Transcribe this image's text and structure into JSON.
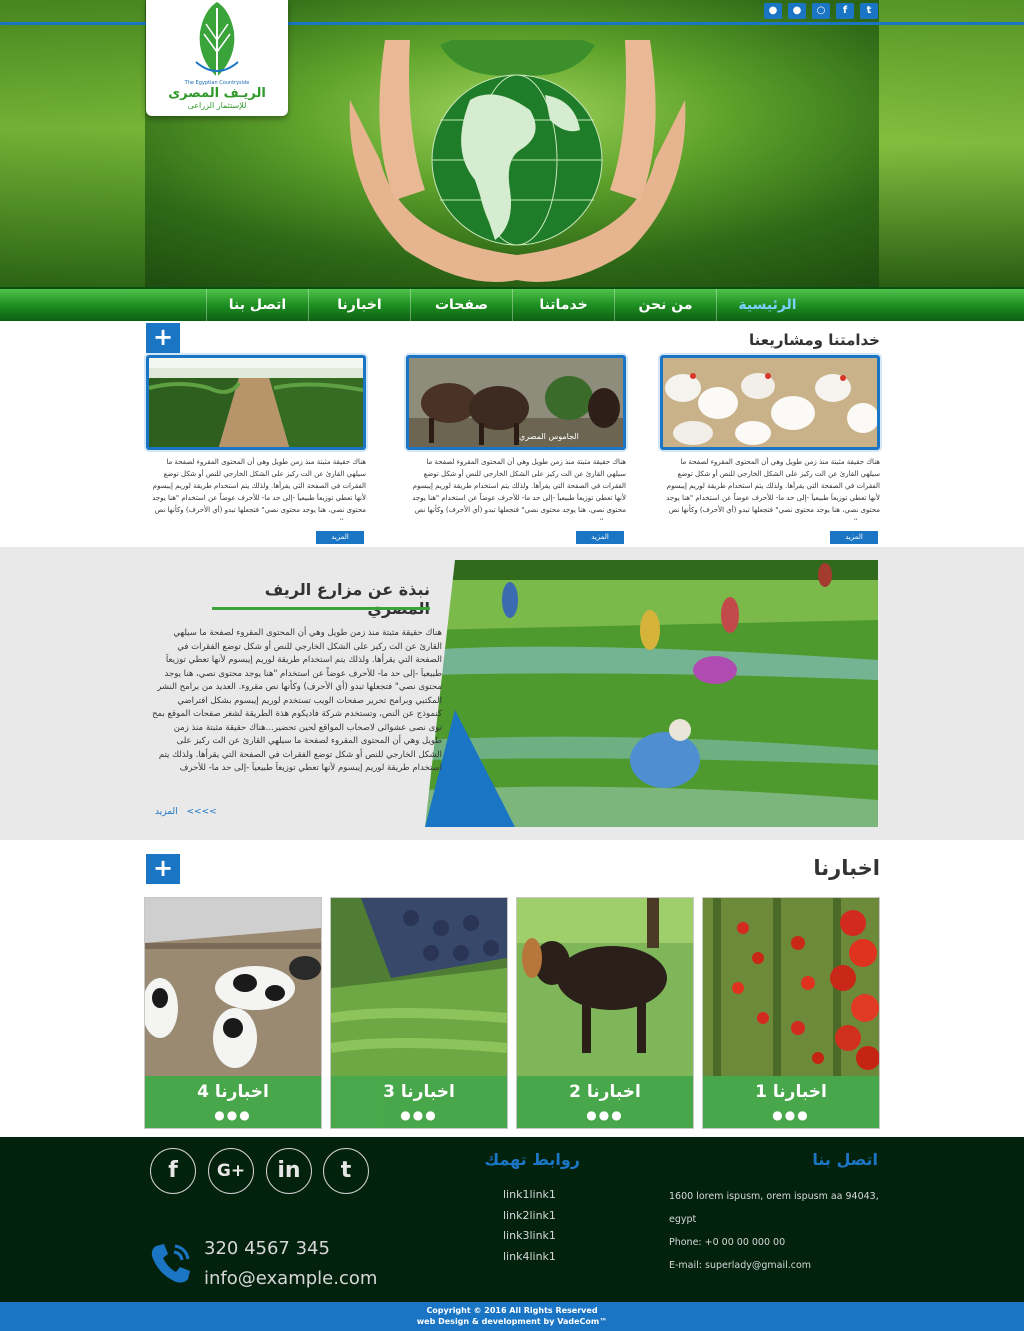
{
  "brand": {
    "name_en": "The Egyptian Countryside",
    "name_ar": "الريـف المصرى",
    "tagline_ar": "للإستثمار الزراعى"
  },
  "topbar": {
    "social_icons": [
      "twitter-icon",
      "facebook-icon",
      "rss-icon",
      "globe-icon",
      "lock-icon"
    ]
  },
  "nav": {
    "items": [
      {
        "label": "الرئيسية",
        "active": true
      },
      {
        "label": "من نحن",
        "active": false
      },
      {
        "label": "خدماتنا",
        "active": false
      },
      {
        "label": "صفحات",
        "active": false
      },
      {
        "label": "اخبارنا",
        "active": false
      },
      {
        "label": "اتصل بنا",
        "active": false
      }
    ]
  },
  "services": {
    "title": "خدامتنا ومشاريعنا",
    "plus": "+",
    "more": "المزيد",
    "items": [
      {
        "image": "chickens",
        "text": "هناك حقيقة مثبتة منذ زمن طويل وهي أن المحتوى المقروء لصفحة ما سيلهي القارئ عن الت ركيز على الشكل الخارجي للنص أو شكل توضع الفقرات في الصفحة التي يقرأها. ولذلك يتم استخدام طريقة لوريم إيبسوم لأنها تعطي توزيعاَ طبيعياَ -إلى حد ما- للأحرف عوضاً عن استخدام \"هنا يوجد محتوى نصي، هنا يوجد محتوى نصي\" فتجعلها تبدو (أي الأحرف) وكأنها نص مقروء. العديد"
      },
      {
        "image": "cattle",
        "caption": "الجاموس المصري",
        "text": "هناك حقيقة مثبتة منذ زمن طويل وهي أن المحتوى المقروء لصفحة ما سيلهي القارئ عن الت ركيز على الشكل الخارجي للنص أو شكل توضع الفقرات في الصفحة التي يقرأها. ولذلك يتم استخدام طريقة لوريم إيبسوم لأنها تعطي توزيعاَ طبيعياَ -إلى حد ما- للأحرف عوضاً عن استخدام \"هنا يوجد محتوى نصي، هنا يوجد محتوى نصي\" فتجعلها تبدو (أي الأحرف) وكأنها نص مقروء. العديد"
      },
      {
        "image": "greenhouse",
        "text": "هناك حقيقة مثبتة منذ زمن طويل وهي أن المحتوى المقروء لصفحة ما سيلهي القارئ عن الت ركيز على الشكل الخارجي للنص أو شكل توضع الفقرات في الصفحة التي يقرأها. ولذلك يتم استخدام طريقة لوريم إيبسوم لأنها تعطي توزيعاَ طبيعياَ -إلى حد ما- للأحرف عوضاً عن استخدام \"هنا يوجد محتوى نصي، هنا يوجد محتوى نصي\" فتجعلها تبدو (أي الأحرف) وكأنها نص مقروء. العديد"
      }
    ]
  },
  "about": {
    "title": "نبذة عن مزارع الريف المصري",
    "text": "هناك حقيقة مثبتة منذ زمن طويل وهي أن المحتوى المقروء لصفحة ما سيلهي القارئ عن الت ركيز على الشكل الخارجي للنص أو شكل توضع الفقرات في الصفحة التي يقرأها. ولذلك يتم استخدام طريقة لوريم إيبسوم لأنها تعطي توزيعاَ طبيعياَ -إلى حد ما- للأحرف عوضاً عن استخدام \"هنا يوجد محتوى نصي، هنا يوجد محتوى نصي\" فتجعلها تبدو (أي الأحرف) وكأنها نص مقروء. العديد من برامح النشر المكتبي وبرامح تحرير صفحات الويب تستخدم لوريم إيبسوم بشكل افتراضي كنموذج عن النص، وتستخدم شركة فاديكوم هذة الطريقة لشغر صفحات الموقع بمح توى نصى عشوائى لاصحاب المواقع لحين تحضير...هناك حقيقة مثبتة منذ زمن طويل وهي أن المحتوى المقروء لصفحة ما سيلهي القارئ عن الت ركيز على الشكل الخارجي للنص أو شكل توضع الفقرات في الصفحة التي يقرأها. ولذلك يتم استخدام طريقة لوريم إيبسوم لأنها تعطي توزيعاَ طبيعياَ -إلى حد ما- للأحرف",
    "more": "المزيد",
    "more_arrows": "<<<<"
  },
  "news": {
    "title": "اخبارنا",
    "plus": "+",
    "items": [
      {
        "title": "اخبارنا 1",
        "image": "tomatoes",
        "dots": "●●●"
      },
      {
        "title": "اخبارنا 2",
        "image": "cow",
        "dots": "●●●"
      },
      {
        "title": "اخبارنا 3",
        "image": "seedlings",
        "dots": "●●●"
      },
      {
        "title": "اخبارنا 4",
        "image": "dairy-cows",
        "dots": "●●●"
      }
    ]
  },
  "footer": {
    "contact_title": "اتصل بنا",
    "address": "1600 lorem ispusm, orem ispusm aa 94043, egypt",
    "phone_line": "Phone: +0 00 00 000  00",
    "email_line": "E-mail: superlady@gmail.com",
    "links_title": "روابط تهمك",
    "links": [
      "link1link1",
      "link2link1",
      "link3link1",
      "link4link1"
    ],
    "socials": [
      {
        "icon": "facebook-icon",
        "glyph": "f"
      },
      {
        "icon": "google-plus-icon",
        "glyph": "G+"
      },
      {
        "icon": "linkedin-icon",
        "glyph": "in"
      },
      {
        "icon": "twitter-icon",
        "glyph": "t"
      }
    ],
    "phone_big": "320 4567 345",
    "email_big": "info@example.com",
    "copyright": "Copyright © 2016 All Rights Reserved",
    "credit": "web Design & development by VadeCom™"
  },
  "colors": {
    "accent_blue": "#1a76c4",
    "nav_green": "#1e8f22",
    "footer_bg": "#03220e",
    "caption_green": "#3fa341"
  }
}
